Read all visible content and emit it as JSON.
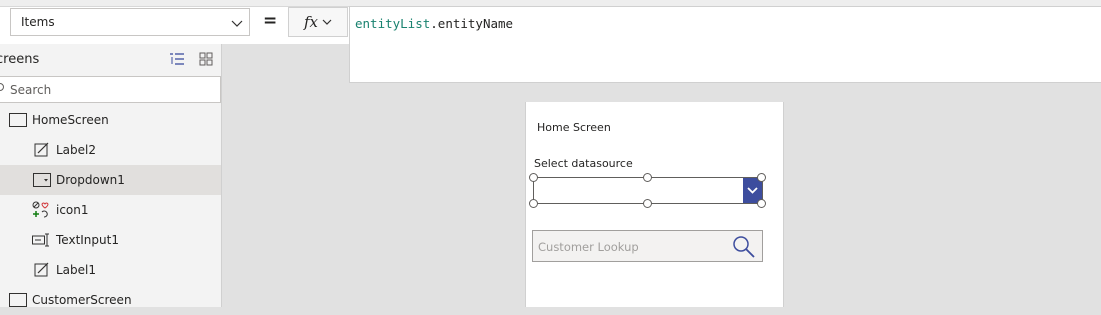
{
  "formula_bar": {
    "property": "Items",
    "equals": "=",
    "fx_label": "fx",
    "formula_fn": "entityList",
    "formula_dot": ".",
    "formula_field": "entityName"
  },
  "tree": {
    "title": "creens",
    "search_placeholder": "Search",
    "nodes": [
      {
        "label": "HomeScreen",
        "icon": "screen-icon"
      },
      {
        "label": "Label2",
        "icon": "label-icon"
      },
      {
        "label": "Dropdown1",
        "icon": "dropdown-icon",
        "selected": true
      },
      {
        "label": "icon1",
        "icon": "icon-control-icon"
      },
      {
        "label": "TextInput1",
        "icon": "text-input-icon"
      },
      {
        "label": "Label1",
        "icon": "label-icon"
      },
      {
        "label": "CustomerScreen",
        "icon": "screen-icon"
      }
    ]
  },
  "canvas": {
    "screen_title": "Home Screen",
    "datasource_label": "Select datasource",
    "lookup_placeholder": "Customer Lookup"
  },
  "colors": {
    "accent": "#3d4d9e",
    "formula_fn": "#19826f",
    "selected_row": "#e1dfdd"
  }
}
